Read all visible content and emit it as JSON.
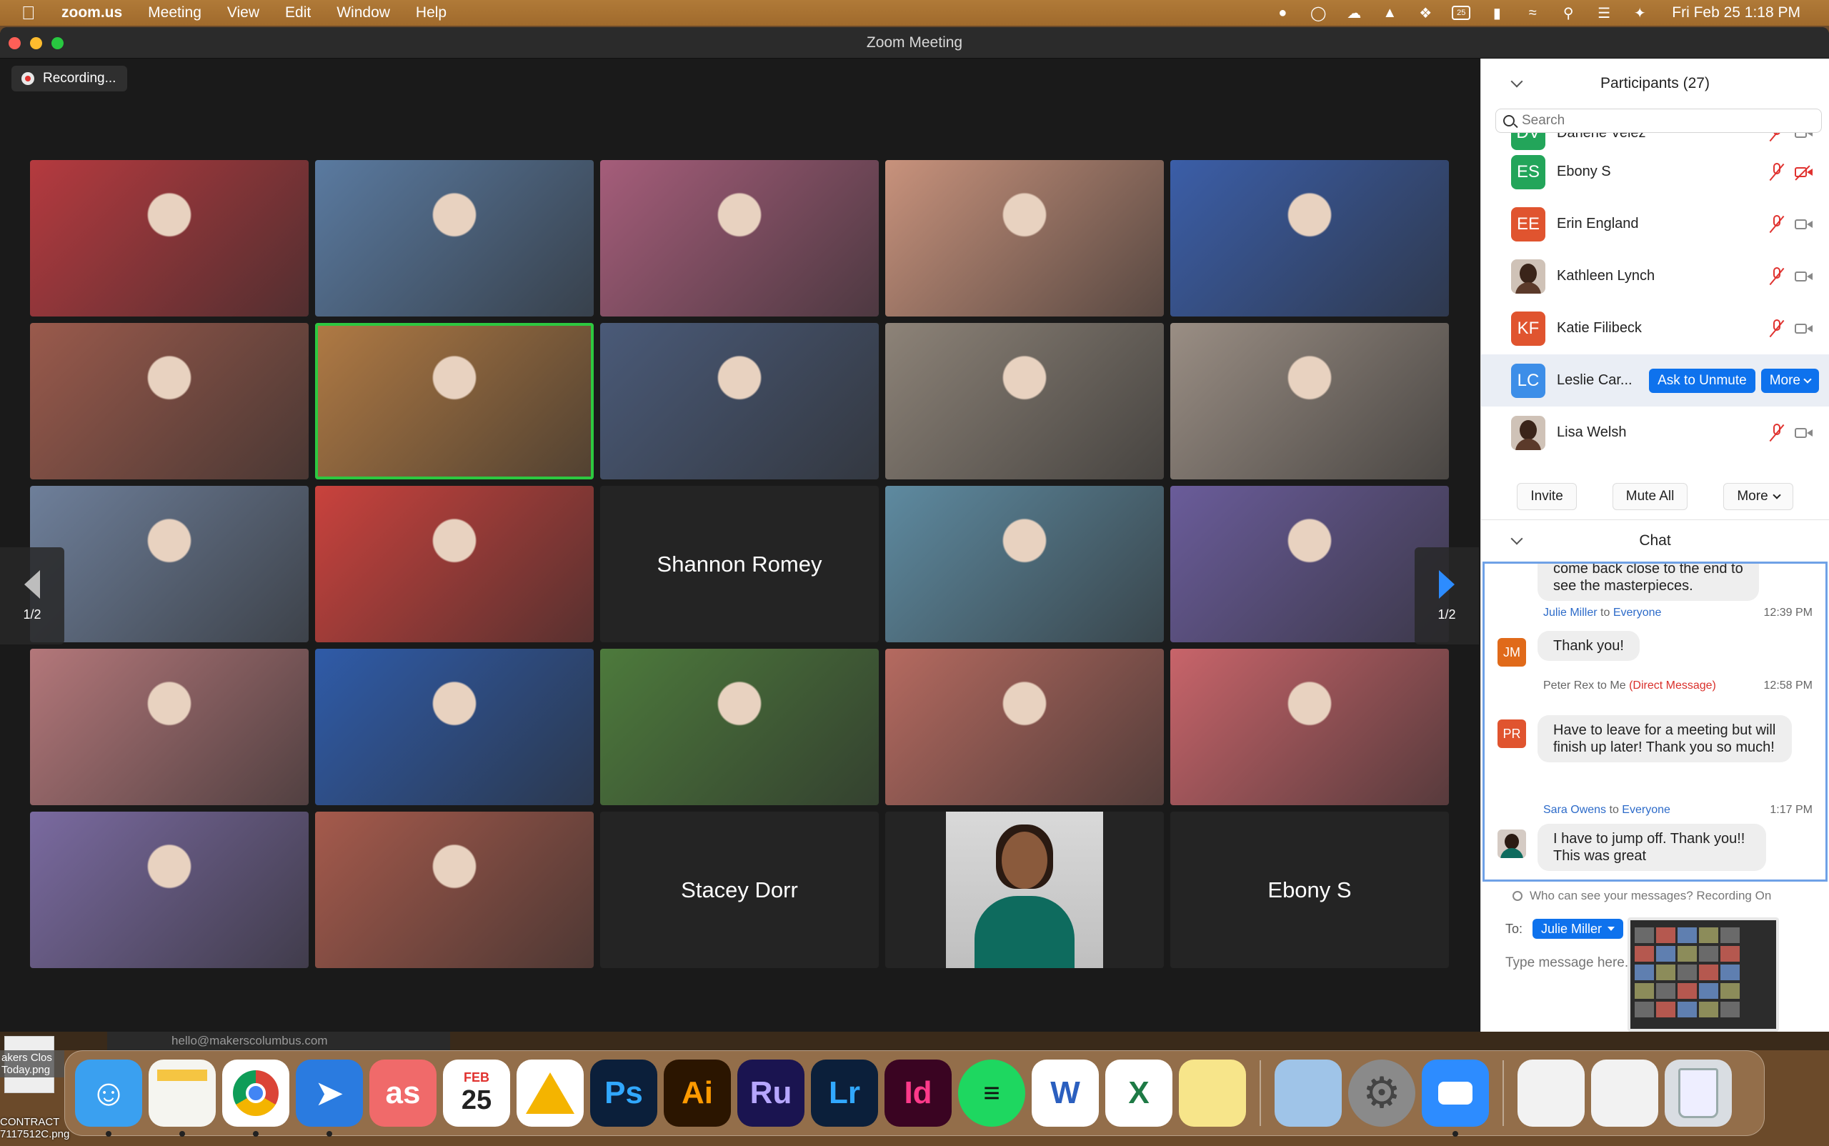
{
  "menubar": {
    "app": "zoom.us",
    "items": [
      "Meeting",
      "View",
      "Edit",
      "Window",
      "Help"
    ],
    "datetime": "Fri Feb 25  1:18 PM",
    "calendar_badge": "25"
  },
  "window": {
    "title": "Zoom Meeting"
  },
  "recording": {
    "label": "Recording..."
  },
  "pager": {
    "left": "1/2",
    "right": "1/2"
  },
  "tiles": [
    {
      "name": "",
      "color": "#b53a3f"
    },
    {
      "name": "",
      "color": "#5a7aa0"
    },
    {
      "name": "",
      "color": "#a55d7a"
    },
    {
      "name": "",
      "color": "#c8927c"
    },
    {
      "name": "",
      "color": "#3b5ea8"
    },
    {
      "name": "",
      "color": "#9a5a4c"
    },
    {
      "name": "",
      "color": "#b07a44",
      "active": true
    },
    {
      "name": "",
      "color": "#4a5a78"
    },
    {
      "name": "",
      "color": "#8d8378"
    },
    {
      "name": "",
      "color": "#9a8e84"
    },
    {
      "name": "",
      "color": "#6e7f9a"
    },
    {
      "name": "",
      "color": "#c9423d"
    },
    {
      "name": "Shannon Romey",
      "color": "#242424"
    },
    {
      "name": "",
      "color": "#5e8aa0"
    },
    {
      "name": "",
      "color": "#6a5c9a"
    },
    {
      "name": "",
      "color": "#b3777a"
    },
    {
      "name": "",
      "color": "#2f5ba8"
    },
    {
      "name": "",
      "color": "#4d7a3c"
    },
    {
      "name": "",
      "color": "#b56a60"
    },
    {
      "name": "",
      "color": "#c8646a"
    },
    {
      "name": "",
      "color": "#7a6aa0"
    },
    {
      "name": "",
      "color": "#a55a4c"
    },
    {
      "name": "Stacey Dorr",
      "color": "#242424"
    },
    {
      "name": "",
      "color": "#242424",
      "photo": true
    },
    {
      "name": "Ebony S",
      "color": "#242424"
    }
  ],
  "participants": {
    "title": "Participants (27)",
    "search_placeholder": "Search",
    "rows": [
      {
        "initials": "DV",
        "name": "Darlene Velez",
        "color": "#23a55a",
        "cut": true
      },
      {
        "initials": "ES",
        "name": "Ebony S",
        "color": "#23a55a",
        "cam_off": true
      },
      {
        "initials": "EE",
        "name": "Erin England",
        "color": "#e0542f"
      },
      {
        "initials": "",
        "name": "Kathleen Lynch",
        "photo": true
      },
      {
        "initials": "KF",
        "name": "Katie Filibeck",
        "color": "#e0542f"
      },
      {
        "initials": "LC",
        "name": "Leslie Car...",
        "color": "#3d8ee8",
        "hover": true
      },
      {
        "initials": "",
        "name": "Lisa Welsh",
        "photo": true
      }
    ],
    "ask_unmute": "Ask to Unmute",
    "more_small": "More",
    "invite": "Invite",
    "mute_all": "Mute All",
    "more": "More"
  },
  "chat": {
    "title": "Chat",
    "top_fragment": "come back close to the end to\nsee the masterpieces.",
    "messages": [
      {
        "initials": "JM",
        "color": "#e06a1a",
        "sender": "Julie Miller",
        "to": "to",
        "recipient": "Everyone",
        "time": "12:39 PM",
        "text": "Thank you!"
      },
      {
        "initials": "PR",
        "color": "#e0542f",
        "sender": "Peter Rex to Me",
        "dm": "(Direct Message)",
        "time": "12:58 PM",
        "text": "Have to leave for a meeting but will finish up later! Thank you so much!"
      },
      {
        "initials": "",
        "photo": true,
        "sender": "Sara Owens",
        "to": "to",
        "recipient": "Everyone",
        "time": "1:17 PM",
        "text": "I have to jump off. Thank you!! This was great"
      }
    ],
    "who_can_see": "Who can see your messages? Recording On",
    "to_label": "To:",
    "to_value": "Julie Miller",
    "input_placeholder": "Type message here..."
  },
  "email_tab": "hello@makerscolumbus.com",
  "desktop_file": {
    "label_top": "akers Clos Today.png",
    "label_bottom": "CONTRACT 7117512C.png"
  },
  "dock": [
    {
      "id": "finder",
      "label": "",
      "bg": "#3aa0f0",
      "running": true
    },
    {
      "id": "notes",
      "label": "",
      "bg": "#f5f5f0",
      "running": true
    },
    {
      "id": "chrome",
      "label": "",
      "bg": "#ffffff",
      "running": true
    },
    {
      "id": "testflight",
      "label": "",
      "bg": "#2a7be0",
      "running": true
    },
    {
      "id": "asana",
      "label": "as",
      "bg": "#f06a6a",
      "running": true
    },
    {
      "id": "calendar-feb",
      "label": "25",
      "sub": "FEB",
      "bg": "#ffffff"
    },
    {
      "id": "drive",
      "label": "",
      "bg": "#ffffff"
    },
    {
      "id": "photoshop",
      "label": "Ps",
      "bg": "#0b1f3a",
      "fg": "#31a8ff"
    },
    {
      "id": "illustrator",
      "label": "Ai",
      "bg": "#2b1500",
      "fg": "#ff9a00"
    },
    {
      "id": "rush",
      "label": "Ru",
      "bg": "#1a1450",
      "fg": "#b6a6ff"
    },
    {
      "id": "lightroom",
      "label": "Lr",
      "bg": "#0b1f3a",
      "fg": "#31a8ff"
    },
    {
      "id": "indesign",
      "label": "Id",
      "bg": "#3a0422",
      "fg": "#ff3a8a"
    },
    {
      "id": "spotify",
      "label": "",
      "bg": "#1ed760"
    },
    {
      "id": "word",
      "label": "W",
      "bg": "#ffffff",
      "fg": "#2b5fbf"
    },
    {
      "id": "excel",
      "label": "X",
      "bg": "#ffffff",
      "fg": "#1e7a45"
    },
    {
      "id": "stickies",
      "label": "",
      "bg": "#f7e58a"
    },
    {
      "id": "preview",
      "label": "",
      "bg": "#9fc4e8"
    },
    {
      "id": "settings",
      "label": "",
      "bg": "#8a8a8a"
    },
    {
      "id": "zoom",
      "label": "",
      "bg": "#2d8cff",
      "running": true
    },
    {
      "id": "doc1",
      "label": "",
      "bg": "#f2f2f2"
    },
    {
      "id": "doc2",
      "label": "",
      "bg": "#f2f2f2"
    },
    {
      "id": "trash",
      "label": "",
      "bg": "#d9dde2"
    }
  ]
}
